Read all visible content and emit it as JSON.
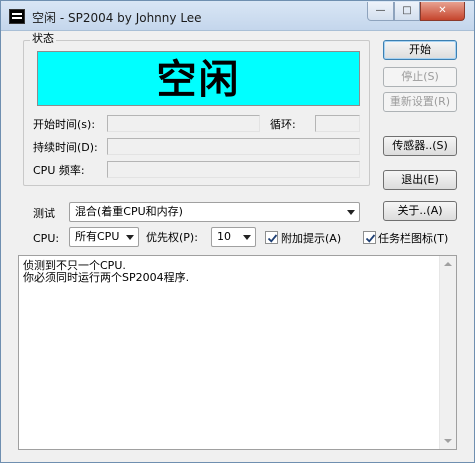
{
  "window": {
    "title": "空闲 - SP2004 by Johnny Lee",
    "controls": {
      "minimize": "—",
      "maximize": "□",
      "close": "✕"
    }
  },
  "status_group": {
    "label": "状态",
    "display_text": "空闲",
    "display_color": "#00ffff",
    "start_time_label": "开始时间(s):",
    "start_time_value": "",
    "loop_label": "循环:",
    "loop_value": "",
    "duration_label": "持续时间(D):",
    "duration_value": "",
    "cpu_freq_label": "CPU 频率:",
    "cpu_freq_value": ""
  },
  "buttons": {
    "start": "开始",
    "stop": "停止(S)",
    "reset": "重新设置(R)",
    "sensors": "传感器..(S)",
    "exit": "退出(E)",
    "about": "关于..(A)"
  },
  "test": {
    "label": "测试",
    "selected": "混合(着重CPU和内存)"
  },
  "cpu": {
    "label": "CPU:",
    "selected": "所有CPU",
    "priority_label": "优先权(P):",
    "priority_selected": "10",
    "extra_tips_label": "附加提示(A)",
    "extra_tips_checked": true,
    "tray_icon_label": "任务栏图标(T)",
    "tray_icon_checked": true
  },
  "log": {
    "lines": [
      "侦测到不只一个CPU.",
      "你必须同时运行两个SP2004程序."
    ]
  }
}
